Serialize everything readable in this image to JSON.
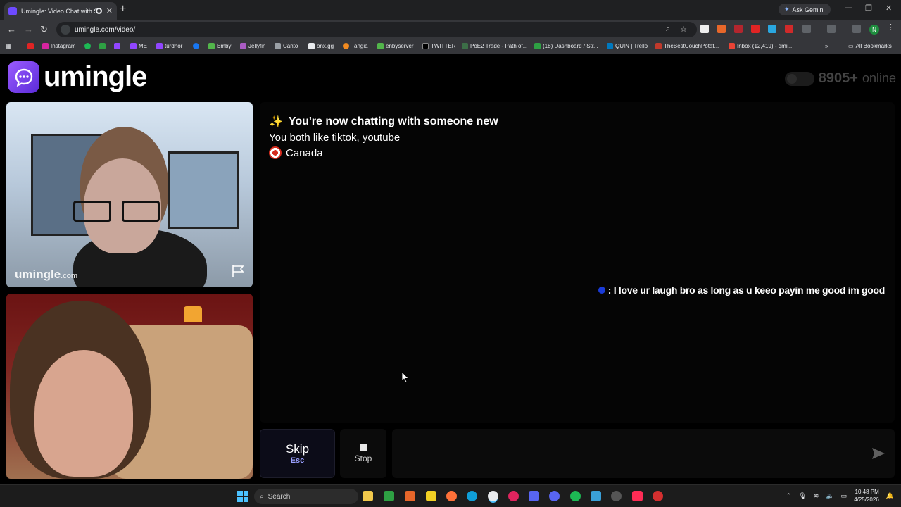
{
  "browser": {
    "tab_title": "Umingle: Video Chat with S",
    "new_tab": "+",
    "ask_gemini": "Ask Gemini",
    "url": "umingle.com/video/",
    "bookmarks": [
      "Instagram",
      "ME",
      "turdnor",
      "Emby",
      "Jellyfin",
      "Canto",
      "onx.gg",
      "Tangia",
      "enbyserver",
      "TWITTER",
      "PoE2 Trade - Path of...",
      "(18) Dashboard / Str...",
      "QUIN | Trello",
      "TheBestCouchPotat...",
      "Inbox (12,419) - qmi..."
    ],
    "all_bookmarks": "All Bookmarks",
    "profile_initial": "N"
  },
  "header": {
    "logo_text": "umingle",
    "online_count": "8905+",
    "online_label": "online"
  },
  "video": {
    "watermark_main": "umingle",
    "watermark_suffix": ".com"
  },
  "chat": {
    "sparkle": "✨",
    "new_chat": "You're now chatting with someone new",
    "interests": "You both like tiktok, youtube",
    "country": "Canada",
    "message": ": I love ur laugh bro as long as u keeo payin me good im good"
  },
  "controls": {
    "skip_label": "Skip",
    "skip_hint": "Esc",
    "stop_label": "Stop",
    "message_placeholder": ""
  },
  "taskbar": {
    "search_label": "Search",
    "time": "10:48 PM",
    "date": "4/25/2026"
  },
  "colors": {
    "brand": "#7b3ff2",
    "skip_hint": "#9aa0ff",
    "message_dot": "#1a3bd8"
  }
}
